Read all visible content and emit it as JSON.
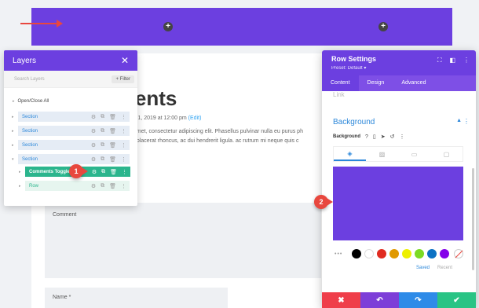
{
  "canvas": {
    "top_section_plus": "+",
    "post_title": "nents",
    "post_meta_prefix": "y 1, 2019 at 12:00 pm",
    "post_meta_edit": "(Edit)",
    "post_text_line1": "amet, consectetur adipiscing elit. Phasellus pulvinar nulla eu purus ph",
    "post_text_line2": "t placerat rhoncus, ac dui hendrerit ligula. ac rutrum mi neque quis c",
    "comment_label": "Comment",
    "name_label": "Name *"
  },
  "layers": {
    "title": "Layers",
    "close": "✕",
    "search_placeholder": "Search Layers",
    "filter_label": "+ Filter",
    "open_close_all": "Open/Close All",
    "items": [
      {
        "label": "Section",
        "type": "section"
      },
      {
        "label": "Section",
        "type": "section"
      },
      {
        "label": "Section",
        "type": "section"
      },
      {
        "label": "Section",
        "type": "section"
      },
      {
        "label": "Comments Toggle",
        "type": "module"
      },
      {
        "label": "Row",
        "type": "row"
      }
    ]
  },
  "badges": {
    "one": "1",
    "two": "2"
  },
  "row_settings": {
    "title": "Row Settings",
    "preset": "Preset: Default ▾",
    "tabs": [
      "Content",
      "Design",
      "Advanced"
    ],
    "ghost_section": "Link",
    "background_title": "Background",
    "background_label": "Background",
    "selected_color": "#6c3fe0",
    "palette_colors": [
      "#000000",
      "#ffffff",
      "#e02b20",
      "#e09900",
      "#edf000",
      "#7cda24",
      "#0c71c3",
      "#8300e9"
    ],
    "palette_more": "•••",
    "saved_label": "Saved",
    "recent_label": "Recent",
    "footer": {
      "cancel": "✖",
      "undo": "↶",
      "redo": "↷",
      "save": "✔",
      "colors": [
        "#ef3e4a",
        "#7d3ed8",
        "#2e8be8",
        "#29c485"
      ]
    }
  }
}
